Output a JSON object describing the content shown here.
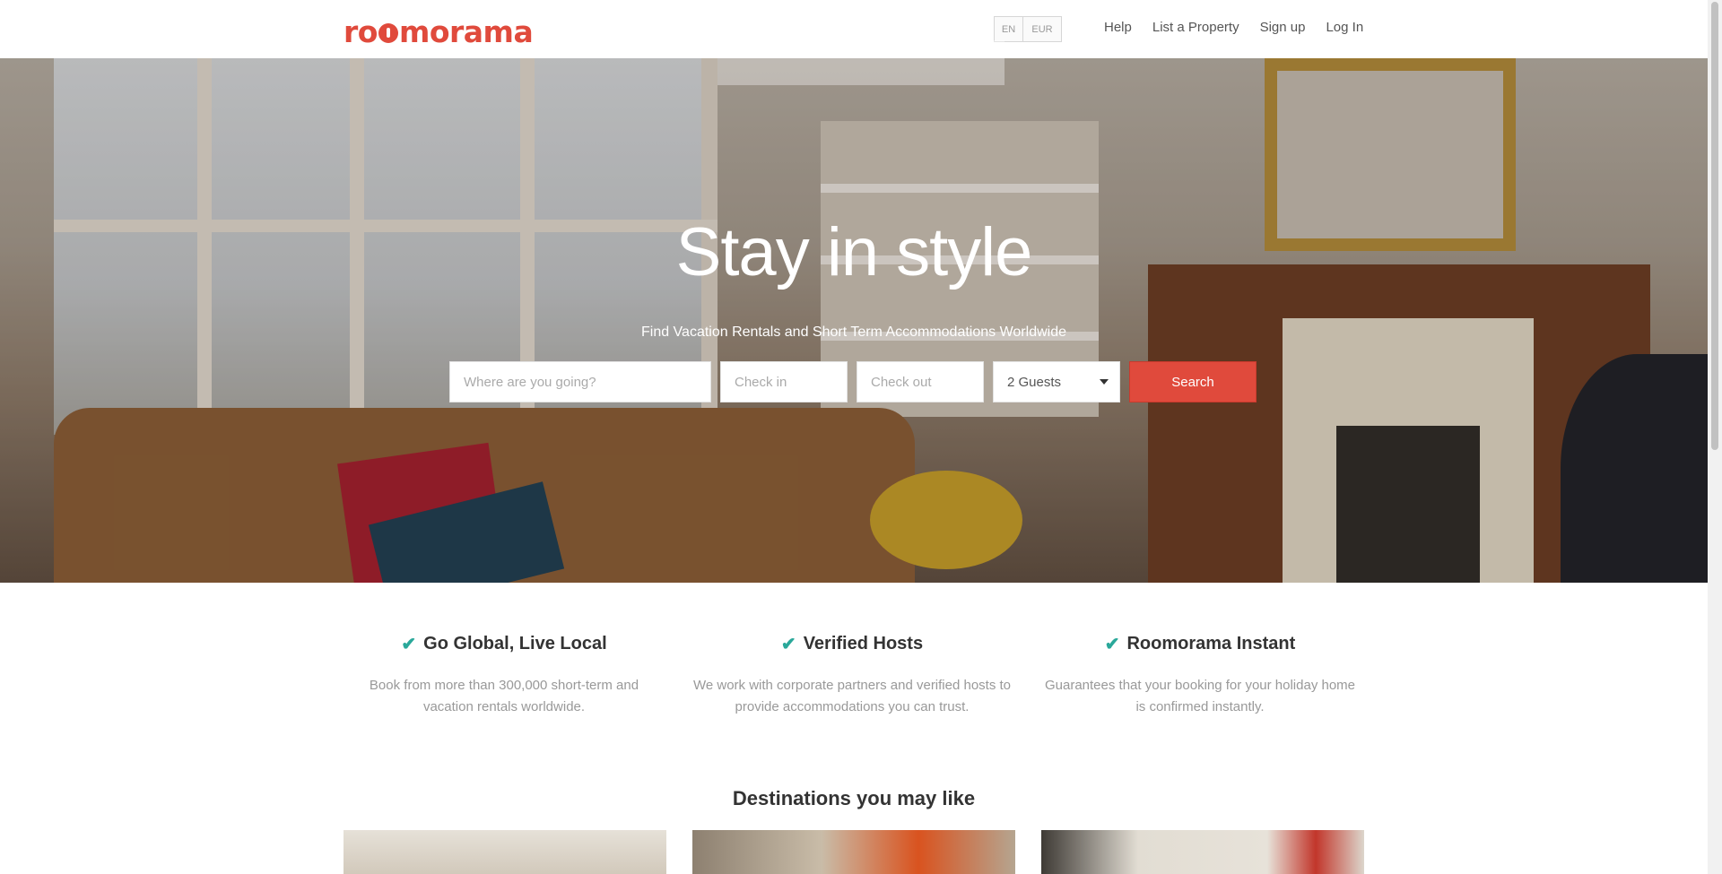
{
  "header": {
    "logo": "roomorama",
    "language": "EN",
    "currency": "EUR",
    "nav": [
      "Help",
      "List a Property",
      "Sign up",
      "Log In"
    ]
  },
  "hero": {
    "title": "Stay in style",
    "subtitle": "Find Vacation Rentals and Short Term Accommodations Worldwide",
    "search": {
      "destination_placeholder": "Where are you going?",
      "checkin_placeholder": "Check in",
      "checkout_placeholder": "Check out",
      "guests": "2 Guests",
      "button": "Search"
    }
  },
  "features": [
    {
      "title": "Go Global, Live Local",
      "text": "Book from more than 300,000 short-term and vacation rentals worldwide."
    },
    {
      "title": "Verified Hosts",
      "text": "We work with corporate partners and verified hosts to provide accommodations you can trust."
    },
    {
      "title": "Roomorama Instant",
      "text": "Guarantees that your booking for your holiday home is confirmed instantly."
    }
  ],
  "destinations": {
    "title": "Destinations you may like"
  },
  "colors": {
    "brand": "#e04a3c",
    "check": "#2aa89a"
  }
}
